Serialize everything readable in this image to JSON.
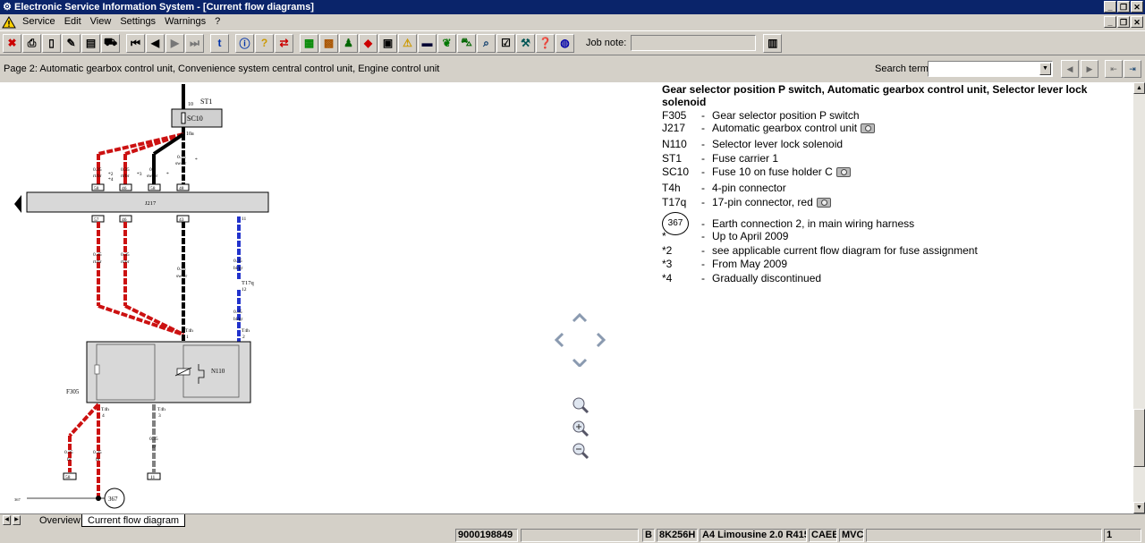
{
  "window": {
    "title": "Electronic Service Information System - [Current flow diagrams]"
  },
  "menu": [
    "Service",
    "Edit",
    "View",
    "Settings",
    "Warnings",
    "?"
  ],
  "toolbar": {
    "job_note_label": "Job note:",
    "job_note_value": ""
  },
  "infobar": {
    "page_label": "Page 2: Automatic gearbox control unit, Convenience system central control unit, Engine control unit",
    "search_label": "Search term:",
    "search_value": ""
  },
  "legend": {
    "title": "Gear selector position P switch, Automatic gearbox control unit, Selector lever lock solenoid",
    "items": [
      {
        "code": "F305",
        "desc": "Gear selector position P switch",
        "camera": false
      },
      {
        "code": "J217",
        "desc": "Automatic gearbox control unit",
        "camera": true
      },
      {
        "code": "N110",
        "desc": "Selector lever lock solenoid",
        "camera": false
      },
      {
        "code": "ST1",
        "desc": "Fuse carrier 1",
        "camera": false
      },
      {
        "code": "SC10",
        "desc": "Fuse 10 on fuse holder C",
        "camera": true
      },
      {
        "code": "T4h",
        "desc": "4-pin connector",
        "camera": false
      },
      {
        "code": "T17q",
        "desc": "17-pin connector, red",
        "camera": true
      },
      {
        "code": "367",
        "desc": "Earth connection 2, in main wiring harness",
        "camera": false,
        "earth": true
      },
      {
        "code": "*",
        "desc": "Up to April 2009",
        "camera": false
      },
      {
        "code": "*2",
        "desc": "see applicable current flow diagram for fuse assignment",
        "camera": false
      },
      {
        "code": "*3",
        "desc": "From May 2009",
        "camera": false
      },
      {
        "code": "*4",
        "desc": "Gradually discontinued",
        "camera": false
      }
    ]
  },
  "diagram": {
    "st1": "ST1",
    "sc10": "SC10",
    "j217": "J217",
    "f305": "F305",
    "n110": "N110",
    "t17q": "T17q",
    "t17q_pin": "12",
    "earth": "367",
    "earth_small": "367",
    "pin10": "10",
    "pin10a": "10a",
    "wires_top": [
      {
        "size": "0.35",
        "color": "rt/br",
        "pin": "58"
      },
      {
        "size": "0.35",
        "color": "rt/br",
        "pin": "46"
      },
      {
        "size": "0.5",
        "color": "sw/br",
        "pin": "58"
      },
      {
        "size": "0.35",
        "color": "sw/br",
        "pin": "48"
      }
    ],
    "pins_bottom": [
      "57",
      "46",
      "43"
    ],
    "pin_11": "11",
    "wires_mid": [
      {
        "size": "0.35",
        "color": "rt/br"
      },
      {
        "size": "0.35",
        "color": "rt/br"
      },
      {
        "size": "0.35",
        "color": "sw/br"
      },
      {
        "size": "0.35",
        "color": "bl/gr"
      },
      {
        "size": "0.35",
        "color": "bl/gr"
      }
    ],
    "t4h": "T4h",
    "t4h_pins": [
      "1",
      "2",
      "4",
      "3"
    ],
    "wires_low": [
      {
        "size": "0.35",
        "color": "br",
        "pin": "58"
      },
      {
        "size": "0.35",
        "color": "br"
      },
      {
        "size": "0.35",
        "color": "gr",
        "pin": "11"
      }
    ],
    "marks": [
      "*",
      "*2",
      "*3",
      "*4"
    ]
  },
  "tabs": [
    "Overview",
    "Current flow diagram"
  ],
  "status": {
    "field1": "9000198849",
    "field2": "",
    "field3": "B",
    "field4": "8K256H",
    "field5": "A4 Limousine 2.0 R415",
    "field6": "CAEB",
    "field7": "MVC",
    "field8": "",
    "field9": "1"
  },
  "colors": {
    "title_bg": "#0a246a",
    "wire_red": "#cc1111",
    "wire_black": "#000000",
    "wire_blue": "#2233cc",
    "wire_grey": "#808080"
  }
}
